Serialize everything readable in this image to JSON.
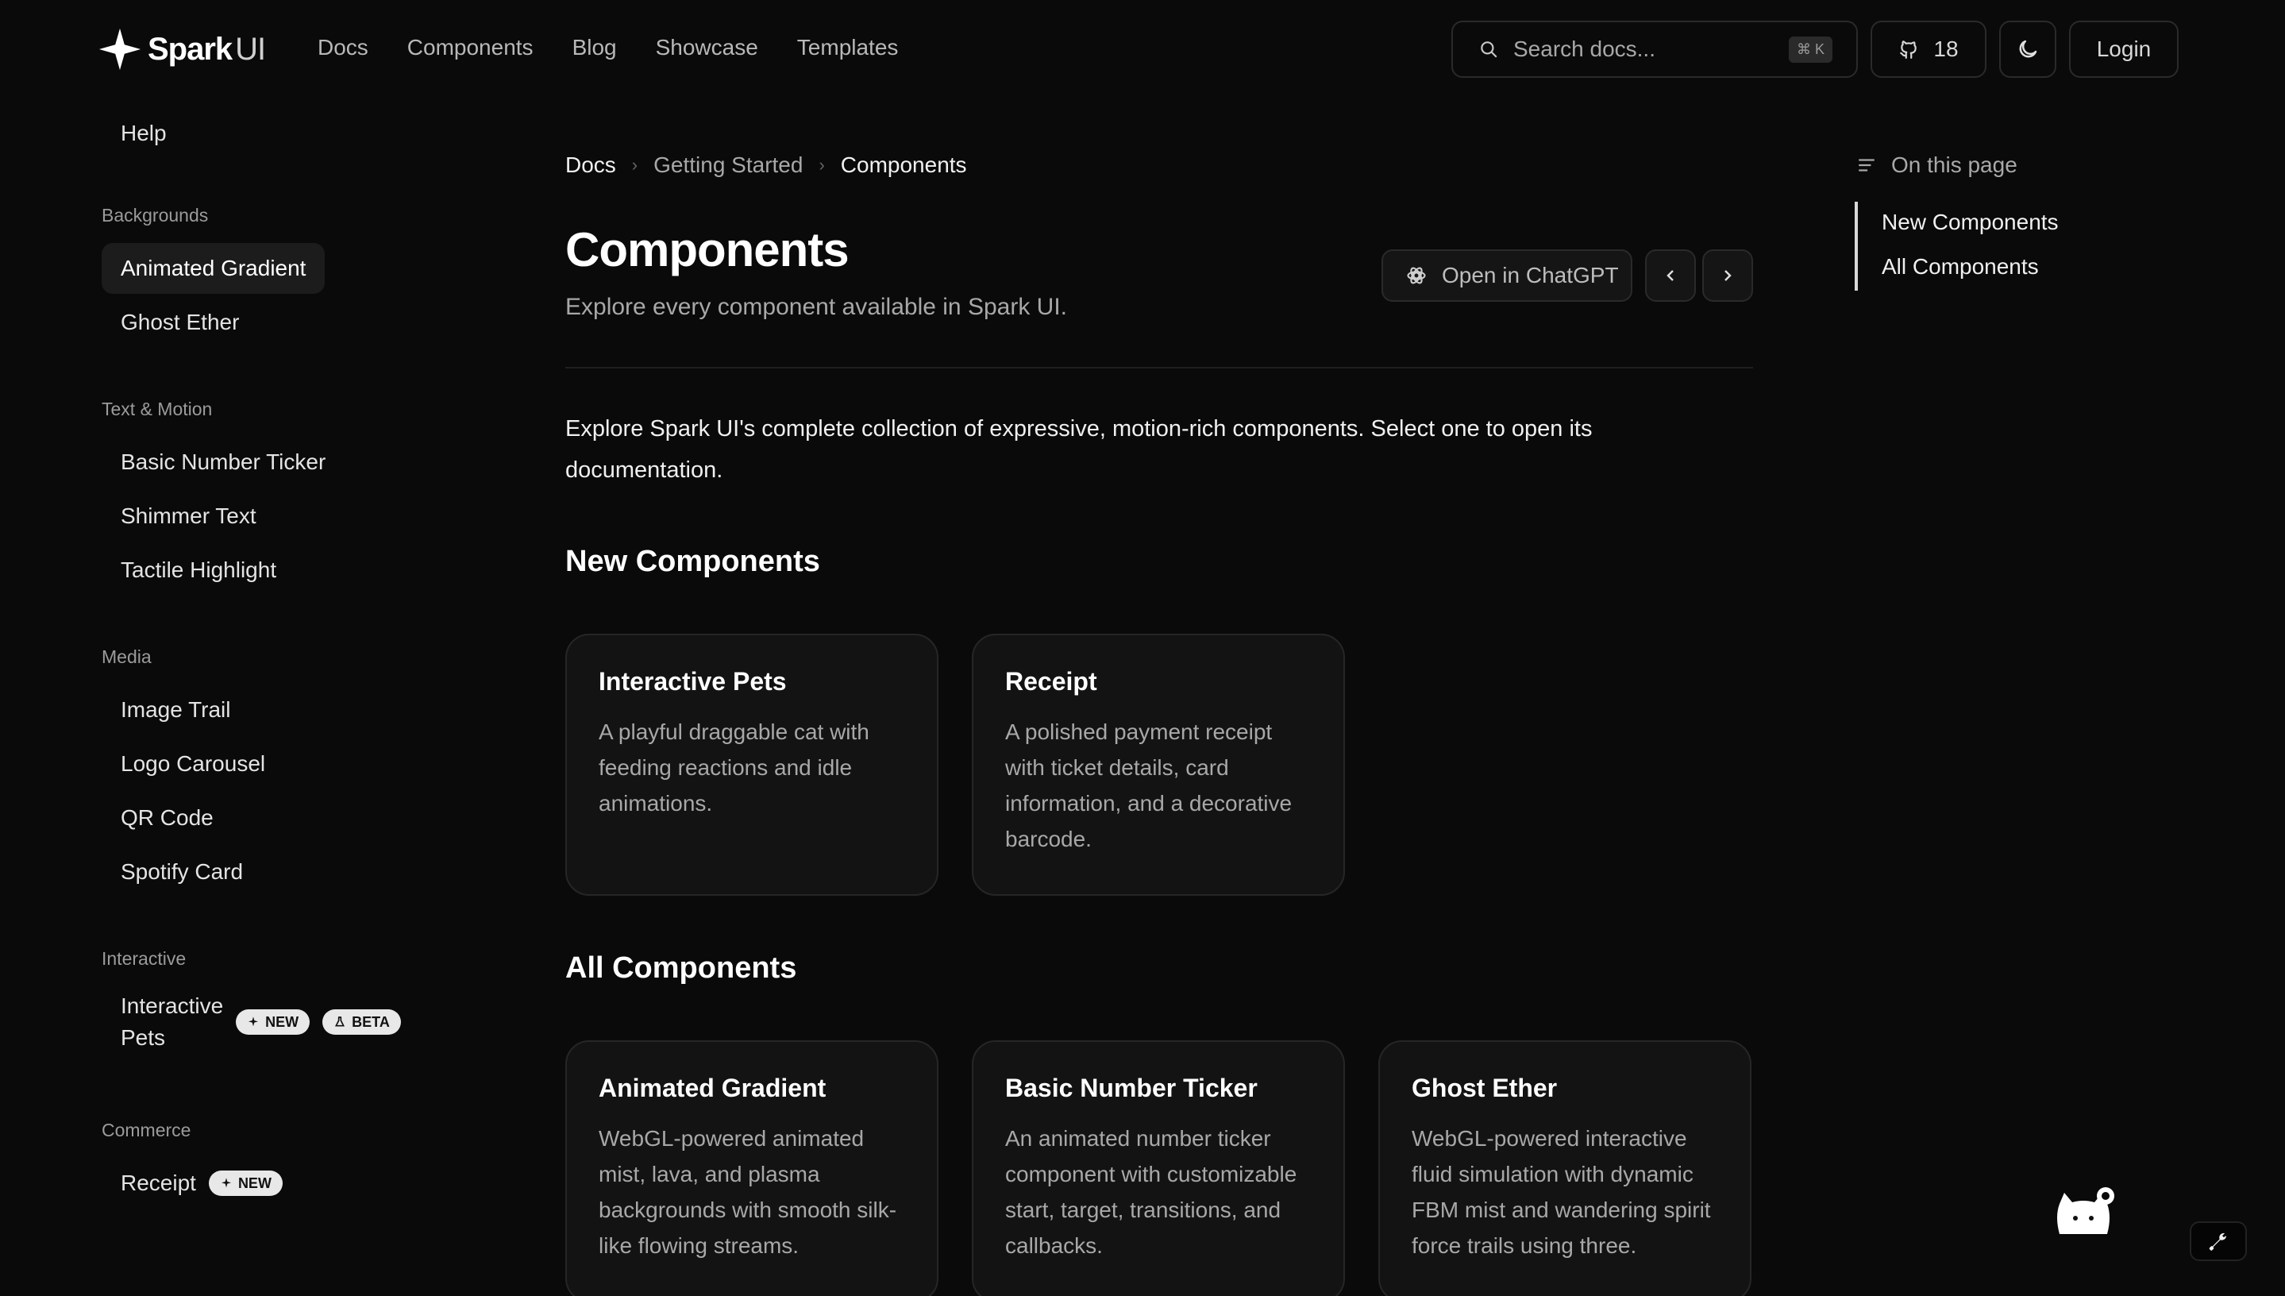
{
  "header": {
    "logo_text": "Spark",
    "logo_suffix": "UI",
    "nav": [
      "Docs",
      "Components",
      "Blog",
      "Showcase",
      "Templates"
    ],
    "search_placeholder": "Search docs...",
    "search_shortcut": "⌘ K",
    "github_stars": "18",
    "login_label": "Login"
  },
  "sidebar": {
    "help": "Help",
    "groups": [
      {
        "title": "Backgrounds",
        "items": [
          "Animated Gradient",
          "Ghost Ether"
        ]
      },
      {
        "title": "Text & Motion",
        "items": [
          "Basic Number Ticker",
          "Shimmer Text",
          "Tactile Highlight"
        ]
      },
      {
        "title": "Media",
        "items": [
          "Image Trail",
          "Logo Carousel",
          "QR Code",
          "Spotify Card"
        ]
      },
      {
        "title": "Interactive",
        "items": [
          "Interactive Pets"
        ]
      },
      {
        "title": "Commerce",
        "items": [
          "Receipt"
        ]
      }
    ],
    "interactive_item_line1": "Interactive",
    "interactive_item_line2": "Pets",
    "badge_new": "NEW",
    "badge_beta": "BETA",
    "active_item": "Animated Gradient"
  },
  "main": {
    "breadcrumb": [
      "Docs",
      "Getting Started",
      "Components"
    ],
    "title": "Components",
    "subtitle": "Explore every component available in Spark UI.",
    "open_chatgpt": "Open in ChatGPT",
    "intro": "Explore Spark UI's complete collection of expressive, motion-rich components. Select one to open its documentation.",
    "new_heading": "New Components",
    "all_heading": "All Components",
    "new_cards": [
      {
        "title": "Interactive Pets",
        "desc": "A playful draggable cat with feeding reactions and idle animations."
      },
      {
        "title": "Receipt",
        "desc": "A polished payment receipt with ticket details, card information, and a decorative barcode."
      }
    ],
    "all_cards": [
      {
        "title": "Animated Gradient",
        "desc": "WebGL-powered animated mist, lava, and plasma backgrounds with smooth silk-like flowing streams."
      },
      {
        "title": "Basic Number Ticker",
        "desc": "An animated number ticker component with customizable start, target, transitions, and callbacks."
      },
      {
        "title": "Ghost Ether",
        "desc": "WebGL-powered interactive fluid simulation with dynamic FBM mist and wandering spirit force trails using three."
      }
    ]
  },
  "toc": {
    "heading": "On this page",
    "items": [
      "New Components",
      "All Components"
    ]
  },
  "colors": {
    "background": "#0a0a0a",
    "card": "#131313",
    "border": "#262626",
    "badge": "#e8e8e8"
  },
  "icons": [
    "spark-logo-icon",
    "search-icon",
    "github-icon",
    "moon-icon",
    "chevron-right-icon",
    "chevron-left-icon",
    "openai-icon",
    "menu-lines-icon",
    "sparkle-icon",
    "flask-icon",
    "cat-icon",
    "wrench-icon"
  ]
}
